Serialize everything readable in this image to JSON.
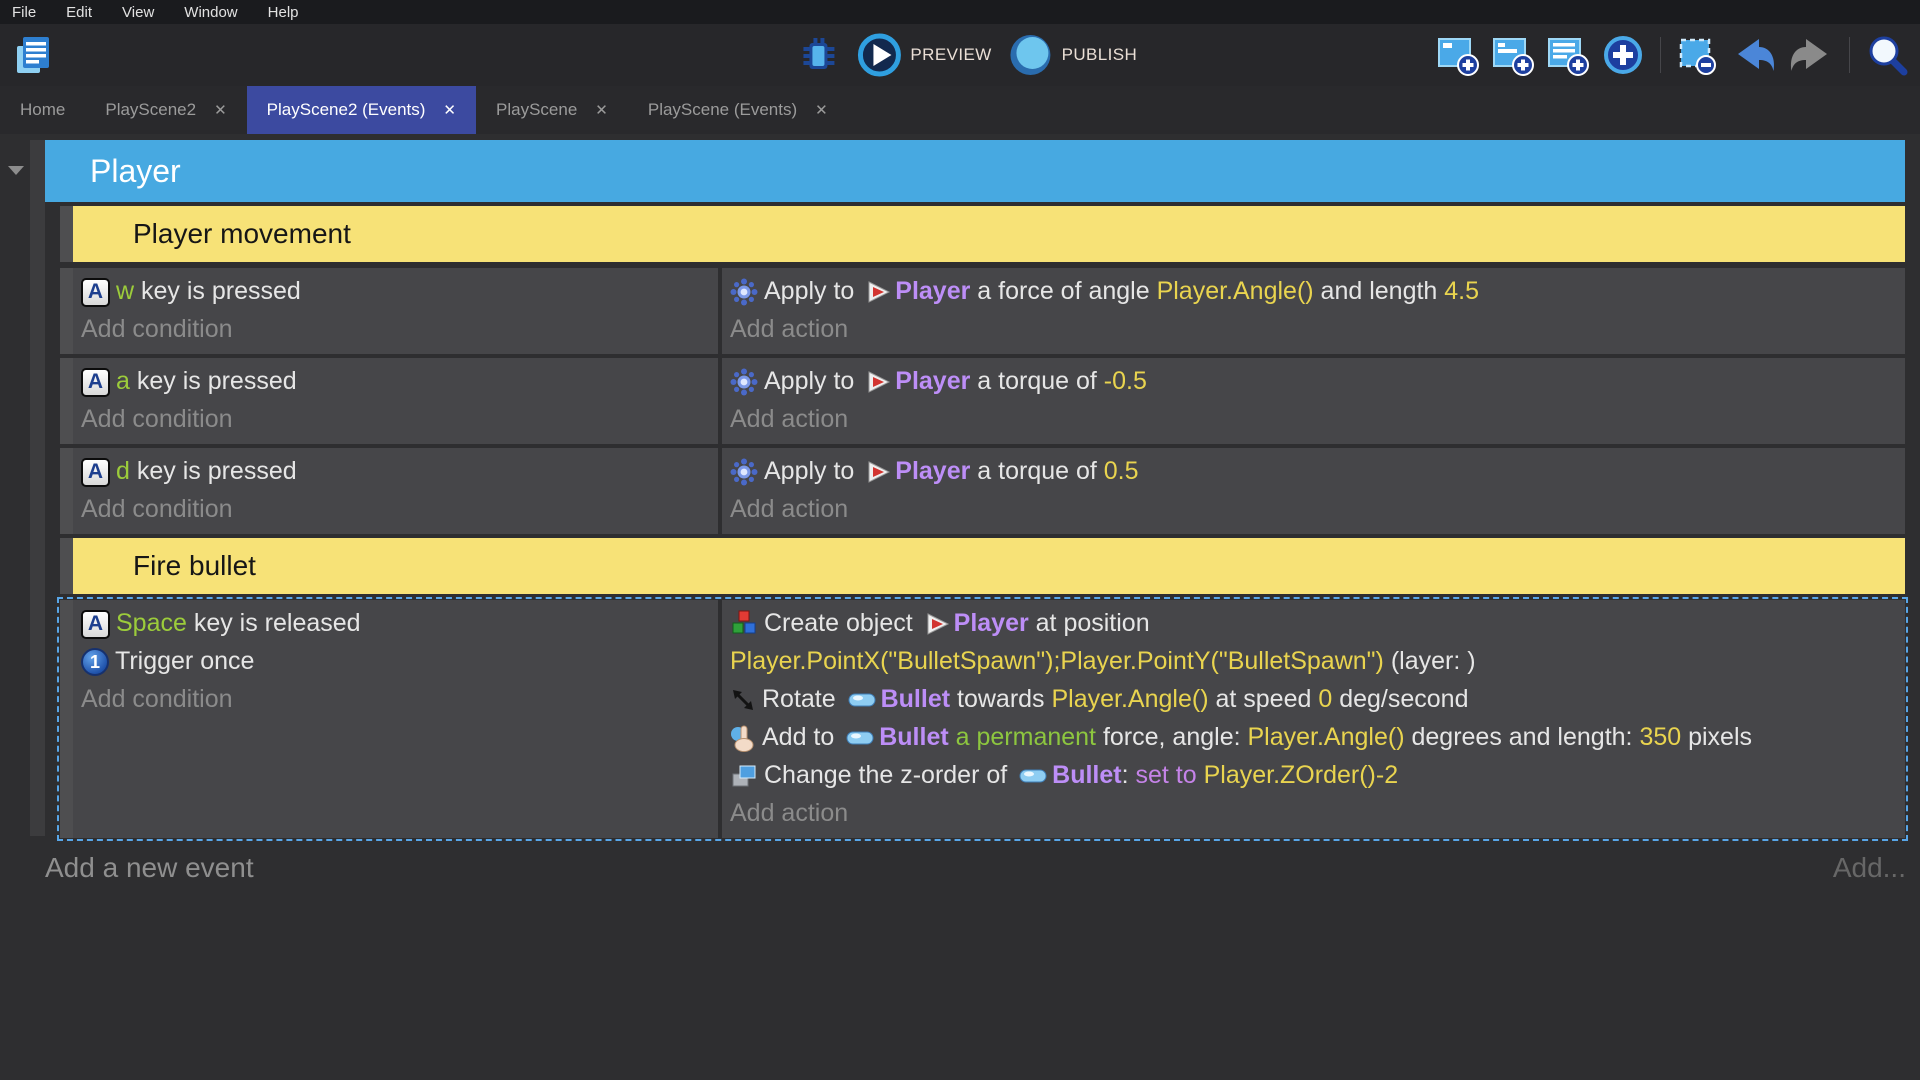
{
  "menu": {
    "items": [
      "File",
      "Edit",
      "View",
      "Window",
      "Help"
    ]
  },
  "toolbar": {
    "preview_label": "PREVIEW",
    "publish_label": "PUBLISH",
    "right_icons": [
      "add-event-icon",
      "add-subevent-icon",
      "add-comment-icon",
      "add-circle-icon",
      "separator",
      "select-instruction-icon",
      "undo-icon",
      "redo-icon",
      "separator",
      "search-icon"
    ]
  },
  "tabs": [
    {
      "label": "Home",
      "closable": false,
      "active": false
    },
    {
      "label": "PlayScene2",
      "closable": true,
      "active": false
    },
    {
      "label": "PlayScene2 (Events)",
      "closable": true,
      "active": true
    },
    {
      "label": "PlayScene",
      "closable": true,
      "active": false
    },
    {
      "label": "PlayScene (Events)",
      "closable": true,
      "active": false
    }
  ],
  "icons": {
    "close_glyph": "✕"
  },
  "labels": {
    "add_condition": "Add condition",
    "add_action": "Add action"
  },
  "events": {
    "group_title": "Player",
    "add_new_event": "Add a new event",
    "add_more": "Add...",
    "rows": [
      {
        "type": "comment",
        "text": "Player movement"
      },
      {
        "type": "event",
        "selected": false,
        "conditions": [
          {
            "icon": "keyboard-icon",
            "tokens": [
              {
                "t": "w",
                "c": "key"
              },
              {
                "t": " key is pressed",
                "c": "plain"
              }
            ]
          }
        ],
        "actions": [
          {
            "icon": "physics-icon",
            "tokens": [
              {
                "t": "Apply to ",
                "c": "plain"
              },
              {
                "icon": "player-icon"
              },
              {
                "t": "Player",
                "c": "object"
              },
              {
                "t": " a force of angle ",
                "c": "plain"
              },
              {
                "t": "Player.Angle()",
                "c": "expr"
              },
              {
                "t": " and length ",
                "c": "plain"
              },
              {
                "t": "4.5",
                "c": "expr"
              }
            ]
          }
        ]
      },
      {
        "type": "event",
        "selected": false,
        "conditions": [
          {
            "icon": "keyboard-icon",
            "tokens": [
              {
                "t": "a",
                "c": "key"
              },
              {
                "t": " key is pressed",
                "c": "plain"
              }
            ]
          }
        ],
        "actions": [
          {
            "icon": "physics-icon",
            "tokens": [
              {
                "t": "Apply to ",
                "c": "plain"
              },
              {
                "icon": "player-icon"
              },
              {
                "t": "Player",
                "c": "object"
              },
              {
                "t": " a torque of ",
                "c": "plain"
              },
              {
                "t": "-0.5",
                "c": "expr"
              }
            ]
          }
        ]
      },
      {
        "type": "event",
        "selected": false,
        "conditions": [
          {
            "icon": "keyboard-icon",
            "tokens": [
              {
                "t": "d",
                "c": "key"
              },
              {
                "t": " key is pressed",
                "c": "plain"
              }
            ]
          }
        ],
        "actions": [
          {
            "icon": "physics-icon",
            "tokens": [
              {
                "t": "Apply to ",
                "c": "plain"
              },
              {
                "icon": "player-icon"
              },
              {
                "t": "Player",
                "c": "object"
              },
              {
                "t": " a torque of ",
                "c": "plain"
              },
              {
                "t": "0.5",
                "c": "expr"
              }
            ]
          }
        ]
      },
      {
        "type": "comment",
        "text": "Fire bullet"
      },
      {
        "type": "event",
        "selected": true,
        "conditions": [
          {
            "icon": "keyboard-icon",
            "tokens": [
              {
                "t": "Space",
                "c": "key"
              },
              {
                "t": " key is released",
                "c": "plain"
              }
            ]
          },
          {
            "icon": "trigger-once-icon",
            "tokens": [
              {
                "t": "Trigger once",
                "c": "plain"
              }
            ]
          }
        ],
        "actions": [
          {
            "icon": "create-icon",
            "tokens": [
              {
                "t": "Create object ",
                "c": "plain"
              },
              {
                "icon": "player-icon"
              },
              {
                "t": "Player",
                "c": "object"
              },
              {
                "t": " at position ",
                "c": "plain"
              },
              {
                "br": true
              },
              {
                "t": "Player.PointX(\"BulletSpawn\");Player.PointY(\"BulletSpawn\")",
                "c": "expr"
              },
              {
                "t": " (layer: )",
                "c": "plain"
              }
            ]
          },
          {
            "icon": "rotate-icon",
            "tokens": [
              {
                "t": "Rotate ",
                "c": "plain"
              },
              {
                "icon": "bullet-icon"
              },
              {
                "t": "Bullet",
                "c": "object"
              },
              {
                "t": " towards ",
                "c": "plain"
              },
              {
                "t": "Player.Angle()",
                "c": "expr"
              },
              {
                "t": " at speed ",
                "c": "plain"
              },
              {
                "t": "0",
                "c": "expr"
              },
              {
                "t": " deg/second",
                "c": "plain"
              }
            ]
          },
          {
            "icon": "force-icon",
            "tokens": [
              {
                "t": "Add to ",
                "c": "plain"
              },
              {
                "icon": "bullet-icon"
              },
              {
                "t": "Bullet",
                "c": "object"
              },
              {
                "t": " a permanent",
                "c": "green"
              },
              {
                "t": " force, angle: ",
                "c": "plain"
              },
              {
                "t": "Player.Angle()",
                "c": "expr"
              },
              {
                "t": " degrees and length: ",
                "c": "plain"
              },
              {
                "t": "350",
                "c": "expr"
              },
              {
                "t": " pixels",
                "c": "plain"
              }
            ]
          },
          {
            "icon": "zorder-icon",
            "tokens": [
              {
                "t": "Change the z-order of ",
                "c": "plain"
              },
              {
                "icon": "bullet-icon"
              },
              {
                "t": "Bullet",
                "c": "object"
              },
              {
                "t": ": ",
                "c": "plain"
              },
              {
                "t": "set to ",
                "c": "operator"
              },
              {
                "t": "Player.ZOrder()-2",
                "c": "expr"
              }
            ]
          }
        ]
      }
    ]
  },
  "colors": {
    "group_header": "#47a9e1",
    "comment": "#f7e277",
    "active_tab": "#3c4aa0",
    "object_text": "#bd8ef7",
    "expression_text": "#e9d44f",
    "key_text": "#9ccc3b",
    "selection_border": "#58a6e8"
  }
}
